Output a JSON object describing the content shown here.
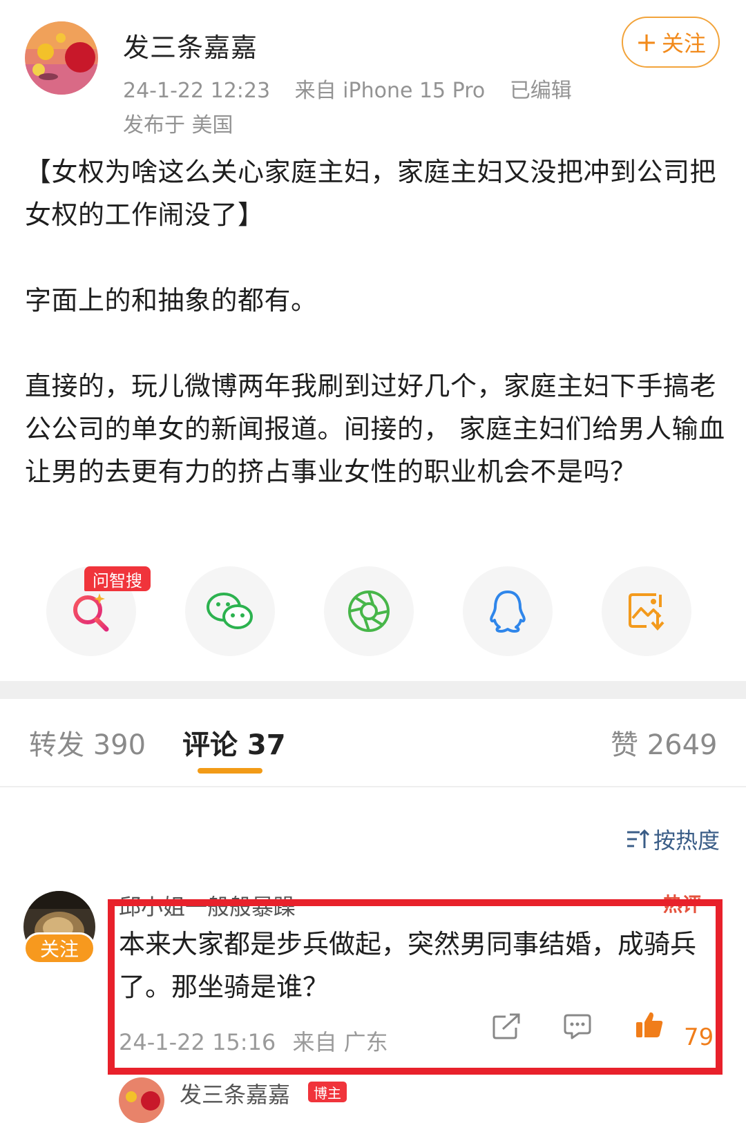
{
  "post": {
    "author": "发三条嘉嘉",
    "follow_label": "关注",
    "follow_plus": "+",
    "time": "24-1-22 12:23",
    "source": "来自 iPhone 15 Pro",
    "edited": "已编辑",
    "ip_location": "发布于 美国",
    "paragraphs": [
      "【女权为啥这么关心家庭主妇，家庭主妇又没把冲到公司把女权的工作闹没了】",
      "字面上的和抽象的都有。",
      "直接的，玩儿微博两年我刷到过好几个，家庭主妇下手搞老公公司的单女的新闻报道。间接的， 家庭主妇们给男人输血让男的去更有力的挤占事业女性的职业机会不是吗？"
    ]
  },
  "share": {
    "ai_badge": "问智搜",
    "icons": [
      "ai-search-icon",
      "wechat-icon",
      "moments-icon",
      "qq-icon",
      "save-image-icon"
    ]
  },
  "tabs": {
    "repost": "转发 390",
    "comments": "评论 37",
    "likes": "赞 2649"
  },
  "sort_label": "按热度",
  "comment": {
    "user": "邱小姐一般般暴躁",
    "tag": "热评",
    "follow_label": "关注",
    "text": "本来大家都是步兵做起，突然男同事结婚，成骑兵了。那坐骑是谁？",
    "time": "24-1-22 15:16",
    "location": "来自 广东",
    "likes": "79"
  },
  "reply": {
    "user": "发三条嘉嘉",
    "badge": "博主"
  },
  "colors": {
    "accent": "#f29b17",
    "highlight": "#e8212b",
    "link_blue": "#3a5d87"
  }
}
